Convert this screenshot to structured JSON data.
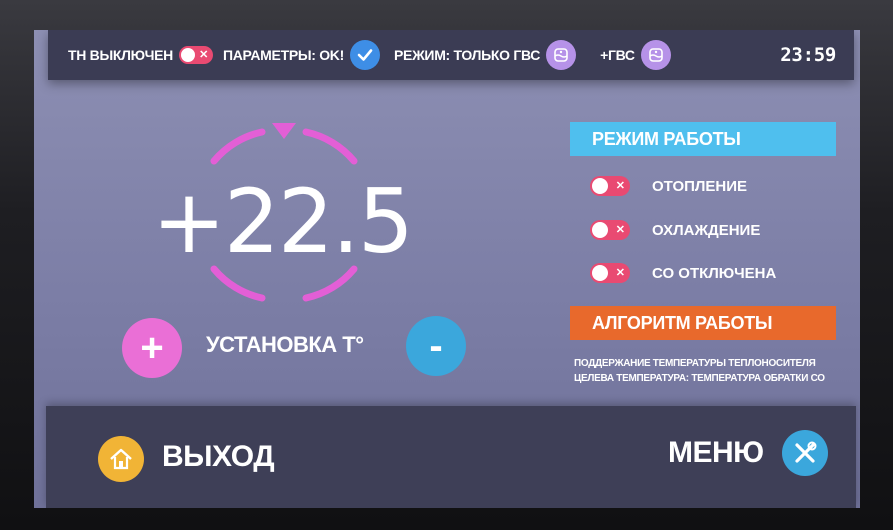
{
  "status_bar": {
    "heat_pump_label": "ТН ВЫКЛЮЧЕН",
    "params_label": "ПАРАМЕТРЫ: OK!",
    "mode_label": "РЕЖИМ: ТОЛЬКО ГВС",
    "dhw_label": "+ГВС",
    "clock": "23:59",
    "icons": {
      "heat_pump_toggle": "toggle-off-icon",
      "params": "check-icon",
      "mode": "water-tank-icon",
      "dhw": "water-tank-icon"
    }
  },
  "setpoint": {
    "value": "+22.5",
    "label": "УСТАНОВКА Т°",
    "plus": "+",
    "minus": "-"
  },
  "operating_mode": {
    "title": "РЕЖИМ РАБОТЫ",
    "items": [
      {
        "label": "ОТОПЛЕНИЕ",
        "state": "off"
      },
      {
        "label": "ОХЛАЖДЕНИЕ",
        "state": "off"
      },
      {
        "label": "СО ОТКЛЮЧЕНА",
        "state": "off"
      }
    ]
  },
  "algorithm": {
    "title": "АЛГОРИТМ РАБОТЫ",
    "line1": "ПОДДЕРЖАНИЕ ТЕМПЕРАТУРЫ ТЕПЛОНОСИТЕЛЯ",
    "line2": "ЦЕЛЕВА ТЕМПЕРАТУРА: ТЕМПЕРАТУРА ОБРАТКИ СО"
  },
  "bottom_bar": {
    "exit_label": "ВЫХОД",
    "menu_label": "МЕНЮ",
    "icons": {
      "exit": "home-icon",
      "menu": "tools-icon"
    }
  },
  "colors": {
    "screen_bg": "#7c7ea6",
    "bar_bg": "#3b3c54",
    "toggle_off": "#e94a72",
    "mode_header": "#4fbfee",
    "algo_header": "#e8692c",
    "plus_button": "#ea6fd6",
    "minus_button": "#3ba7dc",
    "dial_accent": "#e35fd6"
  }
}
